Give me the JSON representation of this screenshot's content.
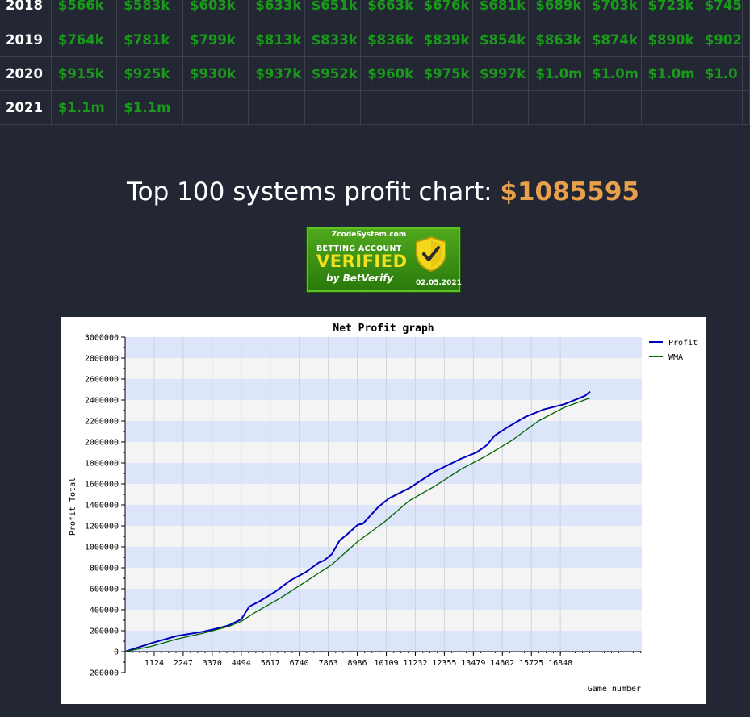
{
  "table": {
    "rows": [
      {
        "year": "2018",
        "values": [
          "$566k",
          "$583k",
          "$603k",
          "$633k",
          "$651k",
          "$663k",
          "$676k",
          "$681k",
          "$689k",
          "$703k",
          "$723k",
          "$745"
        ]
      },
      {
        "year": "2019",
        "values": [
          "$764k",
          "$781k",
          "$799k",
          "$813k",
          "$833k",
          "$836k",
          "$839k",
          "$854k",
          "$863k",
          "$874k",
          "$890k",
          "$902"
        ]
      },
      {
        "year": "2020",
        "values": [
          "$915k",
          "$925k",
          "$930k",
          "$937k",
          "$952k",
          "$960k",
          "$975k",
          "$997k",
          "$1.0m",
          "$1.0m",
          "$1.0m",
          "$1.0"
        ]
      },
      {
        "year": "2021",
        "values": [
          "$1.1m",
          "$1.1m",
          "",
          "",
          "",
          "",
          "",
          "",
          "",
          "",
          "",
          ""
        ]
      }
    ]
  },
  "heading": {
    "text": "Top 100 systems profit chart:",
    "amount": "$1085595"
  },
  "badge": {
    "site": "ZcodeSystem.com",
    "account_label": "BETTING ACCOUNT",
    "verified_label": "VERIFIED",
    "by_label": "by BetVerify",
    "date": "02.05.2021"
  },
  "colors": {
    "background": "#232733",
    "profit_green": "#1a9a1a",
    "amount_orange": "#e8a04c",
    "profit_line": "#0000bb",
    "wma_line": "#006400",
    "band_blue": "#dde5fb",
    "band_light": "#f4f4f4"
  },
  "chart_data": {
    "type": "line",
    "title": "Net Profit graph",
    "xlabel": "Game number",
    "ylabel": "Profit Total",
    "xlim": [
      0,
      20000
    ],
    "ylim": [
      -200000,
      3000000
    ],
    "y_ticks": [
      "3000000",
      "2800000",
      "2600000",
      "2400000",
      "2200000",
      "2000000",
      "1800000",
      "1600000",
      "1400000",
      "1200000",
      "1000000",
      "800000",
      "600000",
      "400000",
      "200000",
      "0",
      "-200000"
    ],
    "x_ticks": [
      "1124",
      "2247",
      "3370",
      "4494",
      "5617",
      "6740",
      "7863",
      "8986",
      "10109",
      "11232",
      "12355",
      "13479",
      "14602",
      "15725",
      "16848"
    ],
    "legend_position": "top-right",
    "series": [
      {
        "name": "Profit",
        "color": "#0000bb",
        "x": [
          0,
          1000,
          2000,
          3000,
          3700,
          4000,
          4500,
          4800,
          5200,
          5800,
          6400,
          7000,
          7500,
          7700,
          8000,
          8300,
          8600,
          9000,
          9200,
          9500,
          9800,
          10200,
          11000,
          12000,
          13000,
          13600,
          14000,
          14300,
          14800,
          15500,
          16200,
          17000,
          17800,
          18000
        ],
        "values": [
          0,
          80000,
          150000,
          190000,
          230000,
          250000,
          310000,
          430000,
          480000,
          570000,
          680000,
          760000,
          850000,
          870000,
          930000,
          1060000,
          1120000,
          1210000,
          1220000,
          1300000,
          1380000,
          1460000,
          1560000,
          1720000,
          1840000,
          1900000,
          1970000,
          2060000,
          2140000,
          2240000,
          2310000,
          2360000,
          2440000,
          2480000
        ]
      },
      {
        "name": "WMA",
        "color": "#006400",
        "x": [
          0,
          1000,
          2000,
          3000,
          4000,
          4500,
          5000,
          6000,
          7000,
          8000,
          9000,
          10000,
          11000,
          12000,
          13000,
          14000,
          15000,
          16000,
          17000,
          18000
        ],
        "values": [
          0,
          50000,
          120000,
          175000,
          240000,
          290000,
          370000,
          510000,
          670000,
          830000,
          1050000,
          1230000,
          1440000,
          1580000,
          1740000,
          1870000,
          2020000,
          2200000,
          2330000,
          2420000
        ]
      }
    ]
  }
}
